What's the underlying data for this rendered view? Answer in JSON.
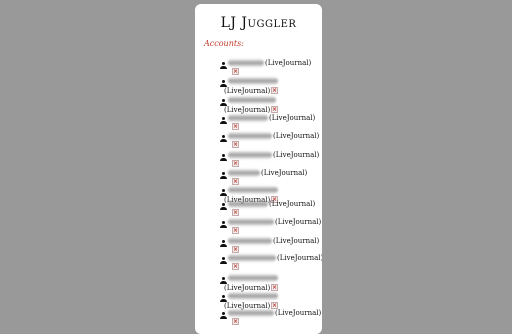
{
  "app": {
    "title": "LJ Juggler",
    "section_label": "Accounts:"
  },
  "accounts": [
    {
      "service": "(LiveJournal)",
      "delete_icon": "close-icon"
    },
    {
      "service": "(LiveJournal)",
      "delete_icon": "close-icon"
    },
    {
      "service": "(LiveJournal)",
      "delete_icon": "close-icon"
    },
    {
      "service": "(LiveJournal)",
      "delete_icon": "close-icon"
    },
    {
      "service": "(LiveJournal)",
      "delete_icon": "close-icon"
    },
    {
      "service": "(LiveJournal)",
      "delete_icon": "close-icon"
    },
    {
      "service": "(LiveJournal)",
      "delete_icon": "close-icon"
    },
    {
      "service": "(LiveJournal)",
      "delete_icon": "close-icon"
    },
    {
      "service": "(LiveJournal)",
      "delete_icon": "close-icon"
    },
    {
      "service": "(LiveJournal)",
      "delete_icon": "close-icon"
    },
    {
      "service": "(LiveJournal)",
      "delete_icon": "close-icon"
    },
    {
      "service": "(LiveJournal)",
      "delete_icon": "close-icon"
    },
    {
      "service": "(LiveJournal)",
      "delete_icon": "close-icon"
    },
    {
      "service": "(LiveJournal)",
      "delete_icon": "close-icon"
    },
    {
      "service": "(LiveJournal)",
      "delete_icon": "close-icon"
    }
  ]
}
